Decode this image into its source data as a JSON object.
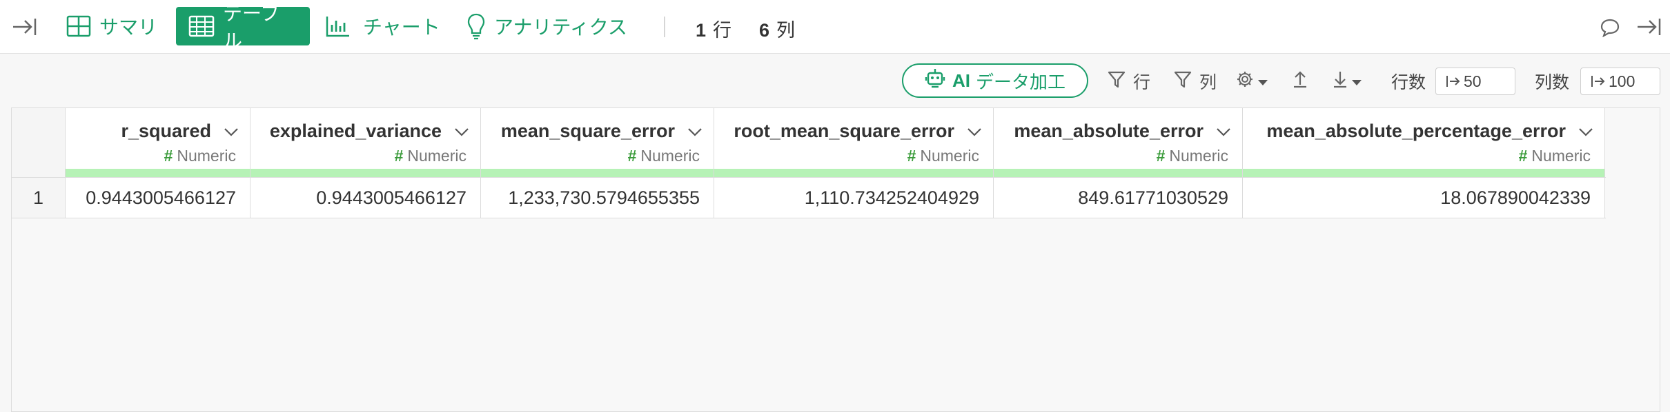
{
  "toolbar": {
    "tabs": [
      {
        "label": "サマリ",
        "icon": "summary-grid-icon"
      },
      {
        "label": "テーブル",
        "icon": "table-icon"
      },
      {
        "label": "チャート",
        "icon": "bar-chart-icon"
      },
      {
        "label": "アナリティクス",
        "icon": "lightbulb-icon"
      }
    ],
    "row_count": "1",
    "row_unit": "行",
    "col_count": "6",
    "col_unit": "列"
  },
  "actions": {
    "ai_button_ai": "AI",
    "ai_button_label": "データ加工",
    "row_filter_label": "行",
    "col_filter_label": "列",
    "rows_label": "行数",
    "rows_value": "50",
    "cols_label": "列数",
    "cols_value": "100"
  },
  "table": {
    "columns": [
      {
        "name": "r_squared",
        "type": "Numeric"
      },
      {
        "name": "explained_variance",
        "type": "Numeric"
      },
      {
        "name": "mean_square_error",
        "type": "Numeric"
      },
      {
        "name": "root_mean_square_error",
        "type": "Numeric"
      },
      {
        "name": "mean_absolute_error",
        "type": "Numeric"
      },
      {
        "name": "mean_absolute_percentage_error",
        "type": "Numeric"
      }
    ],
    "type_hash": "#",
    "rows": [
      {
        "index": "1",
        "cells": [
          "0.9443005466127",
          "0.9443005466127",
          "1,233,730.5794655355",
          "1,110.734252404929",
          "849.61771030529",
          "18.067890042339"
        ]
      }
    ]
  },
  "colors": {
    "accent": "#1a9e6a",
    "type_bar": "#b6f2b6",
    "hash": "#3a9b3a"
  }
}
